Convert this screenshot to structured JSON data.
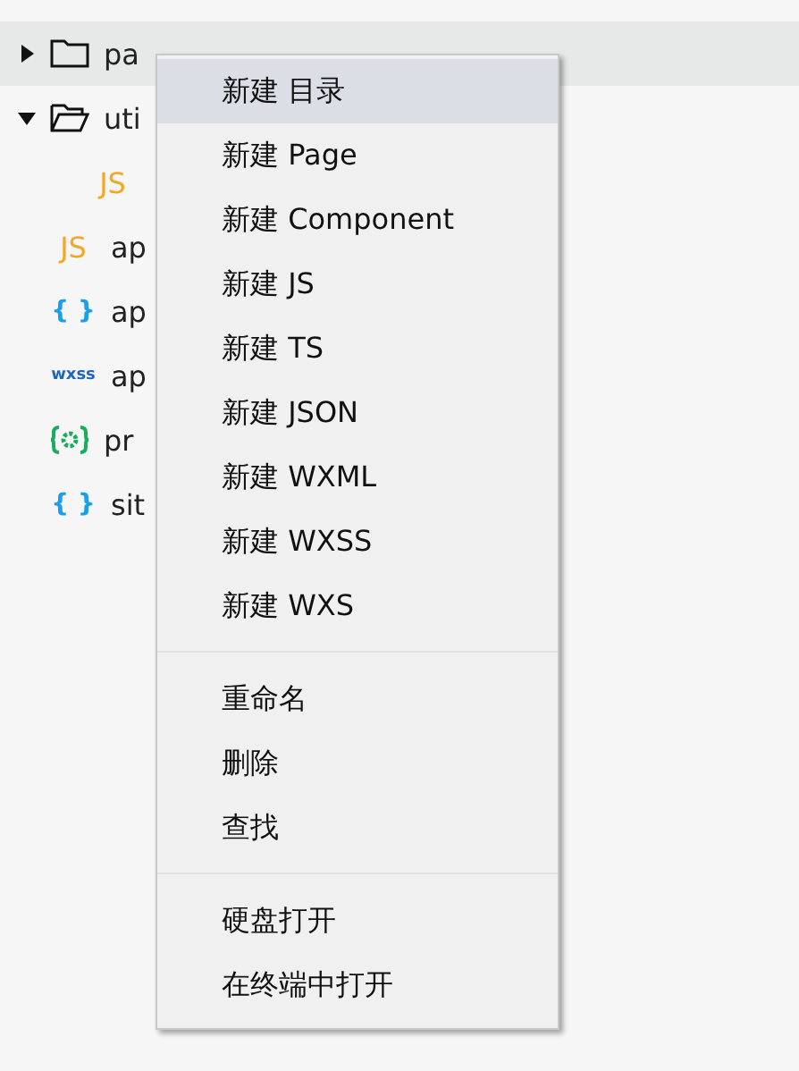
{
  "tree": [
    {
      "kind": "folder",
      "label": "pa",
      "expanded": false,
      "selected": true
    },
    {
      "kind": "folder",
      "label": "uti",
      "expanded": true,
      "selected": false,
      "children": [
        {
          "kind": "js",
          "icon_text": "JS",
          "selected": false
        }
      ]
    },
    {
      "kind": "js",
      "icon_text": "JS",
      "label": "ap",
      "selected": false
    },
    {
      "kind": "json",
      "icon_text": "{ }",
      "label": "ap",
      "selected": false
    },
    {
      "kind": "wxss",
      "icon_text": "wxss",
      "label": "ap",
      "selected": false
    },
    {
      "kind": "config",
      "label": "pr",
      "selected": false
    },
    {
      "kind": "json",
      "icon_text": "{ }",
      "label": "sit",
      "selected": false
    }
  ],
  "context_menu": {
    "groups": [
      [
        {
          "label": "新建 目录",
          "selected": true
        },
        {
          "label": "新建 Page",
          "selected": false
        },
        {
          "label": "新建 Component",
          "selected": false
        },
        {
          "label": "新建 JS",
          "selected": false
        },
        {
          "label": "新建 TS",
          "selected": false
        },
        {
          "label": "新建 JSON",
          "selected": false
        },
        {
          "label": "新建 WXML",
          "selected": false
        },
        {
          "label": "新建 WXSS",
          "selected": false
        },
        {
          "label": "新建 WXS",
          "selected": false
        }
      ],
      [
        {
          "label": "重命名",
          "selected": false
        },
        {
          "label": "删除",
          "selected": false
        },
        {
          "label": "查找",
          "selected": false
        }
      ],
      [
        {
          "label": "硬盘打开",
          "selected": false
        },
        {
          "label": "在终端中打开",
          "selected": false
        }
      ]
    ]
  }
}
